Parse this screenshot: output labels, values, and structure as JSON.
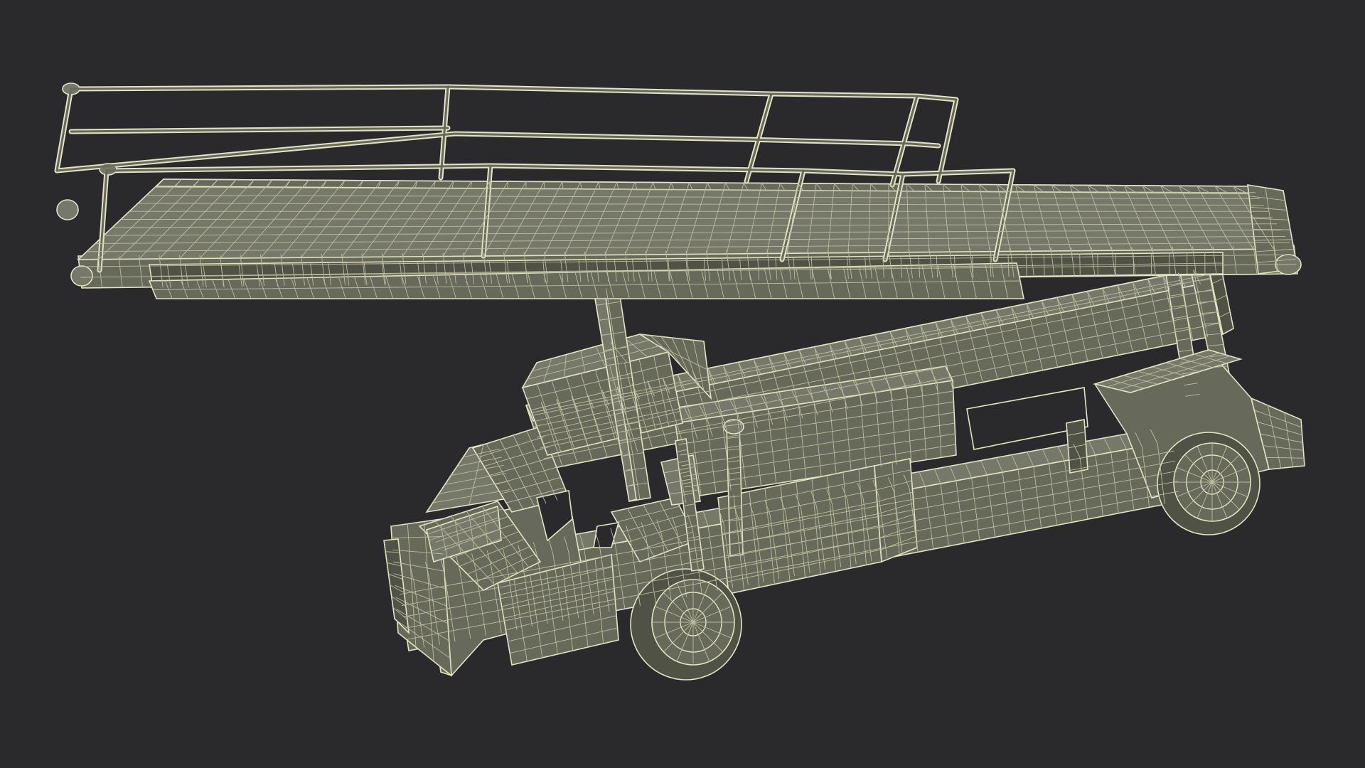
{
  "scene": {
    "subject": "belt-loader-wireframe",
    "colors": {
      "background": "#2a2a2c",
      "surface": "#676a5a",
      "surface_light": "#76796a",
      "surface_dark": "#4f5245",
      "wire": "#e4e3c4",
      "wire_dim": "#bdbca0",
      "hole": "#2a2a2c"
    }
  }
}
